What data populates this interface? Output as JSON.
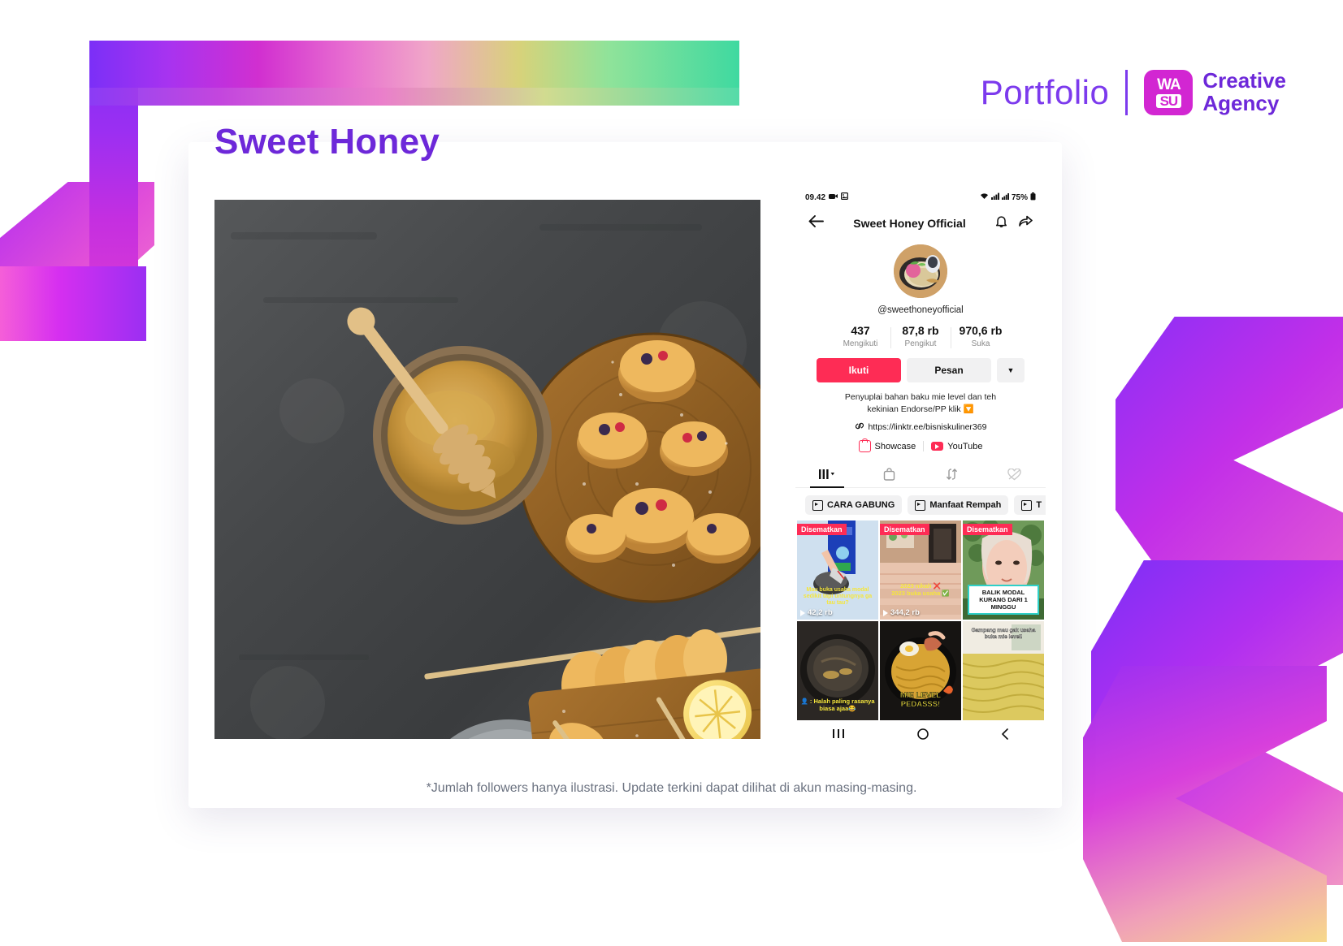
{
  "header": {
    "portfolio_label": "Portfolio",
    "logo": {
      "line1": "WA",
      "line2": "SU",
      "brand_line1": "Creative",
      "brand_line2": "Agency"
    },
    "accent_purple": "#7c3aed",
    "logo_magenta": "#d226d2"
  },
  "page_title": "Sweet Honey",
  "footer_note": "*Jumlah followers hanya ilustrasi. Update terkini dapat dilihat di akun masing-masing.",
  "phone": {
    "status_bar": {
      "time": "09.42",
      "battery": "75%",
      "icons": [
        "camera-icon",
        "gallery-icon",
        "wifi-icon",
        "signal-icon",
        "signal2-icon",
        "battery-icon"
      ]
    },
    "nav": {
      "title": "Sweet Honey Official",
      "back_icon": "back-arrow-icon",
      "bell_icon": "bell-icon",
      "share_icon": "share-icon"
    },
    "handle": "@sweethoneyofficial",
    "stats": [
      {
        "value": "437",
        "label": "Mengikuti"
      },
      {
        "value": "87,8 rb",
        "label": "Pengikut"
      },
      {
        "value": "970,6 rb",
        "label": "Suka"
      }
    ],
    "actions": {
      "follow": "Ikuti",
      "message": "Pesan",
      "caret": "▼",
      "follow_color": "#fe2c55"
    },
    "bio_line1": "Penyuplai bahan baku mie level dan teh",
    "bio_line2": "kekinian Endorse/PP klik",
    "bio_emoji": "🔽",
    "link": "https://linktr.ee/bisniskuliner369",
    "link_icon": "link-icon",
    "social": [
      {
        "label": "Showcase",
        "icon": "showcase-bag-icon"
      },
      {
        "label": "YouTube",
        "icon": "youtube-icon"
      }
    ],
    "tabs": [
      {
        "icon": "grid-posts-icon",
        "active": true
      },
      {
        "icon": "shopping-bag-icon",
        "active": false
      },
      {
        "icon": "repost-icon",
        "active": false
      },
      {
        "icon": "liked-heart-icon",
        "active": false
      }
    ],
    "chips": [
      {
        "label": "CARA GABUNG",
        "icon": "playlist-icon"
      },
      {
        "label": "Manfaat Rempah",
        "icon": "playlist-icon"
      },
      {
        "label": "T",
        "icon": "playlist-icon"
      }
    ],
    "grid": [
      {
        "pinned_label": "Disematkan",
        "views": "42,2 rb",
        "overlay": "Mau buka usaha modal sedikit tapi untungnya ga tau tau?",
        "overlay_color": "#f5e63d",
        "bg": "light-blue-kitchen"
      },
      {
        "pinned_label": "Disematkan",
        "views": "344,2 rb",
        "overlay": "2023 nikah ❌\n2023 buka usaha ✅",
        "overlay_color": "#f5e63d",
        "bg": "warm-room"
      },
      {
        "pinned_label": "Disematkan",
        "views": "",
        "overlay": "BALIK MODAL KURANG DARI 1 MINGGU",
        "overlay_color": "#111111",
        "bg": "portrait-green"
      },
      {
        "pinned_label": "",
        "views": "",
        "overlay": "👤 : Halah paling rasanya biasa ajaa😂",
        "overlay_color": "#f5e63d",
        "bg": "dark-pan"
      },
      {
        "pinned_label": "",
        "views": "",
        "overlay": "MIE LEVEL PEDASSS!",
        "overlay_color": "#f5e63d",
        "bg": "noodle-bowl"
      },
      {
        "pinned_label": "",
        "views": "",
        "overlay": "Gampang mau gak usaha buka mie level!",
        "overlay_color": "#ffffff",
        "bg": "noodle-yellow"
      }
    ],
    "navbar": {
      "recents_icon": "recents-icon",
      "home_icon": "home-circle-icon",
      "back_icon": "back-chevron-icon"
    }
  }
}
